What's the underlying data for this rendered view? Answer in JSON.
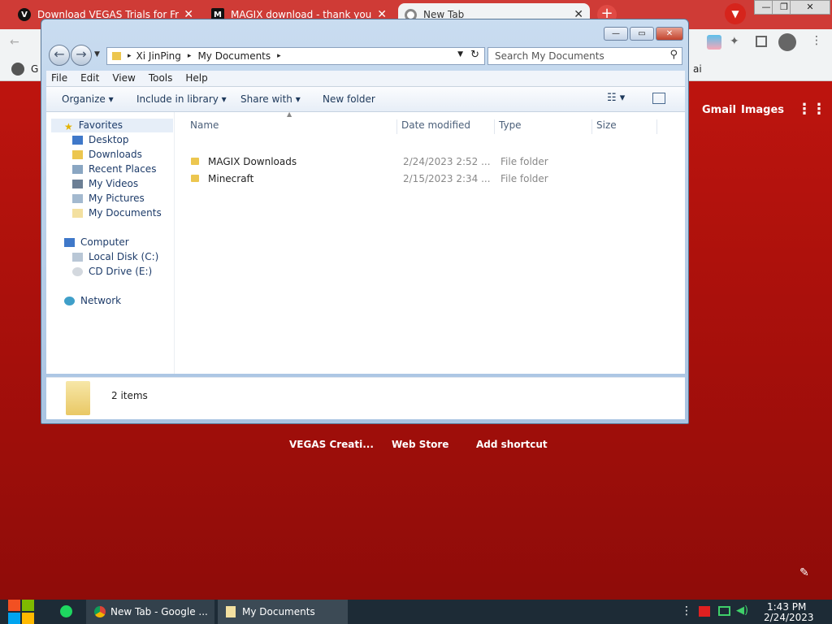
{
  "chrome": {
    "tabs": [
      {
        "label": "Download VEGAS Trials for Fre",
        "favicon": "V"
      },
      {
        "label": "MAGIX download - thank you",
        "favicon": "M"
      },
      {
        "label": "New Tab",
        "favicon": "chrome-icon"
      }
    ],
    "bookmark_prefix": "G",
    "partial_right_text": "ai",
    "google_links": [
      "Gmail",
      "Images"
    ],
    "shortcuts": [
      "VEGAS Creati...",
      "Web Store",
      "Add shortcut"
    ]
  },
  "explorer": {
    "address": [
      "Xi JinPing",
      "My Documents"
    ],
    "search_placeholder": "Search My Documents",
    "menu": [
      "File",
      "Edit",
      "View",
      "Tools",
      "Help"
    ],
    "toolbar": [
      "Organize",
      "Include in library",
      "Share with",
      "New folder"
    ],
    "nav": {
      "favorites": {
        "label": "Favorites",
        "items": [
          "Desktop",
          "Downloads",
          "Recent Places",
          "My Videos",
          "My Pictures",
          "My Documents"
        ]
      },
      "computer": {
        "label": "Computer",
        "items": [
          "Local Disk (C:)",
          "CD Drive (E:)"
        ]
      },
      "network": "Network"
    },
    "columns": [
      "Name",
      "Date modified",
      "Type",
      "Size"
    ],
    "files": [
      {
        "name": "MAGIX Downloads",
        "date": "2/24/2023 2:52 ...",
        "type": "File folder"
      },
      {
        "name": "Minecraft",
        "date": "2/15/2023 2:34 ...",
        "type": "File folder"
      }
    ],
    "status": "2 items"
  },
  "taskbar": {
    "items": [
      "New Tab - Google ...",
      "My Documents"
    ],
    "time": "1:43 PM",
    "date": "2/24/2023"
  },
  "colors": {
    "chrome_top": "#cf3b36",
    "explorer_frame": "#a9c4e2",
    "taskbar": "#1d2b36"
  }
}
